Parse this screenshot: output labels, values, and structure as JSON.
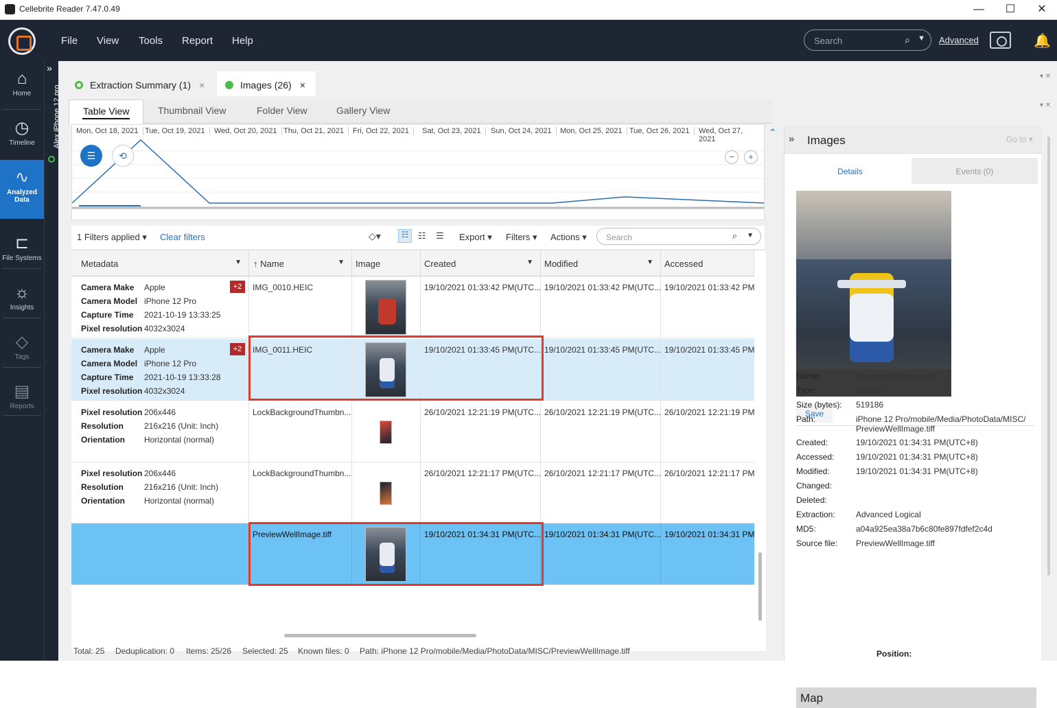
{
  "window": {
    "title": "Cellebrite Reader 7.47.0.49",
    "minimize": "—",
    "maximize": "☐",
    "close": "✕"
  },
  "menu": [
    "File",
    "View",
    "Tools",
    "Report",
    "Help"
  ],
  "top_search": {
    "placeholder": "Search",
    "advanced": "Advanced"
  },
  "nav": [
    {
      "label": "Home",
      "icon": "home-icon",
      "glyph": "⌂"
    },
    {
      "label": "Timeline",
      "icon": "clock-icon",
      "glyph": "◷"
    },
    {
      "label": "Analyzed Data",
      "icon": "pulse-icon",
      "glyph": "∿"
    },
    {
      "label": "File Systems",
      "icon": "tree-icon",
      "glyph": "⊏"
    },
    {
      "label": "Insights",
      "icon": "bulb-icon",
      "glyph": "☼"
    },
    {
      "label": "Tags",
      "icon": "tag-icon",
      "glyph": "◇"
    },
    {
      "label": "Reports",
      "icon": "report-icon",
      "glyph": "▤"
    }
  ],
  "device": {
    "label": "Alex iPhone 12 pro",
    "expand": "»"
  },
  "tabs": [
    {
      "label": "Extraction Summary (1)",
      "close": "×",
      "color": "#4cbb4a",
      "hollow": true
    },
    {
      "label": "Images (26)",
      "close": "×",
      "color": "#4cbb4a",
      "hollow": false
    }
  ],
  "view_tabs": [
    "Table View",
    "Thumbnail View",
    "Folder View",
    "Gallery View"
  ],
  "timeline_dates": [
    "Mon, Oct 18, 2021",
    "Tue, Oct 19, 2021",
    "Wed, Oct 20, 2021",
    "Thu, Oct 21, 2021",
    "Fri, Oct 22, 2021",
    "Sat, Oct 23, 2021",
    "Sun, Oct 24, 2021",
    "Mon, Oct 25, 2021",
    "Tue, Oct 26, 2021",
    "Wed, Oct 27, 2021"
  ],
  "filters": {
    "applied": "1 Filters applied",
    "clear": "Clear filters",
    "export": "Export",
    "filters": "Filters",
    "actions": "Actions",
    "search_placeholder": "Search"
  },
  "columns": [
    "Metadata",
    "Name",
    "Image",
    "Created",
    "Modified",
    "Accessed"
  ],
  "rows": [
    {
      "meta": [
        [
          "Camera Make",
          "Apple"
        ],
        [
          "Camera Model",
          "iPhone 12 Pro"
        ],
        [
          "Capture Time",
          "2021-10-19 13:33:25"
        ],
        [
          "Pixel resolution",
          "4032x3024"
        ]
      ],
      "badge": "+2",
      "name": "IMG_0010.HEIC",
      "created": "19/10/2021 01:33:42 PM(UTC...",
      "modified": "19/10/2021 01:33:42 PM(UTC...",
      "accessed": "19/10/2021 01:33:42 PM("
    },
    {
      "meta": [
        [
          "Camera Make",
          "Apple"
        ],
        [
          "Camera Model",
          "iPhone 12 Pro"
        ],
        [
          "Capture Time",
          "2021-10-19 13:33:28"
        ],
        [
          "Pixel resolution",
          "4032x3024"
        ]
      ],
      "badge": "+2",
      "name": "IMG_0011.HEIC",
      "created": "19/10/2021 01:33:45 PM(UTC...",
      "modified": "19/10/2021 01:33:45 PM(UTC...",
      "accessed": "19/10/2021 01:33:45 PM("
    },
    {
      "meta": [
        [
          "Pixel resolution",
          "206x446"
        ],
        [
          "Resolution",
          "216x216 (Unit: Inch)"
        ],
        [
          "Orientation",
          "Horizontal (normal)"
        ]
      ],
      "badge": "",
      "name": "LockBackgroundThumbn...",
      "created": "26/10/2021 12:21:19 PM(UTC...",
      "modified": "26/10/2021 12:21:19 PM(UTC...",
      "accessed": "26/10/2021 12:21:19 PM("
    },
    {
      "meta": [
        [
          "Pixel resolution",
          "206x446"
        ],
        [
          "Resolution",
          "216x216 (Unit: Inch)"
        ],
        [
          "Orientation",
          "Horizontal (normal)"
        ]
      ],
      "badge": "",
      "name": "LockBackgroundThumbn...",
      "created": "26/10/2021 12:21:17 PM(UTC...",
      "modified": "26/10/2021 12:21:17 PM(UTC...",
      "accessed": "26/10/2021 12:21:17 PM("
    },
    {
      "meta": [],
      "badge": "",
      "name": "PreviewWellImage.tiff",
      "created": "19/10/2021 01:34:31 PM(UTC...",
      "modified": "19/10/2021 01:34:31 PM(UTC...",
      "accessed": "19/10/2021 01:34:31 PM("
    }
  ],
  "status": {
    "total": "Total: 25",
    "dedup": "Deduplication: 0",
    "items": "Items: 25/26",
    "selected": "Selected: 25",
    "known": "Known files: 0",
    "path": "Path: iPhone 12 Pro/mobile/Media/PhotoData/MISC/PreviewWellImage.tiff"
  },
  "panel": {
    "title": "Images",
    "goto": "Go to",
    "tabs": [
      "Details",
      "Events (0)"
    ],
    "save": "Save",
    "details": [
      [
        "Name:",
        "PreviewWellImage.tiff"
      ],
      [
        "Type:",
        "Images"
      ],
      [
        "Size (bytes):",
        "519186"
      ],
      [
        "Path:",
        "iPhone 12 Pro/mobile/Media/PhotoData/MISC/ PreviewWellImage.tiff"
      ],
      [
        "Created:",
        "19/10/2021 01:34:31 PM(UTC+8)"
      ],
      [
        "Accessed:",
        "19/10/2021 01:34:31 PM(UTC+8)"
      ],
      [
        "Modified:",
        "19/10/2021 01:34:31 PM(UTC+8)"
      ],
      [
        "Changed:",
        ""
      ],
      [
        "Deleted:",
        ""
      ],
      [
        "Extraction:",
        "Advanced Logical"
      ],
      [
        "MD5:",
        "a04a925ea38a7b6c80fe897fdfef2c4d"
      ],
      [
        "Source file:",
        "PreviewWellImage.tiff"
      ]
    ],
    "map": "Map",
    "position": "Position:"
  }
}
